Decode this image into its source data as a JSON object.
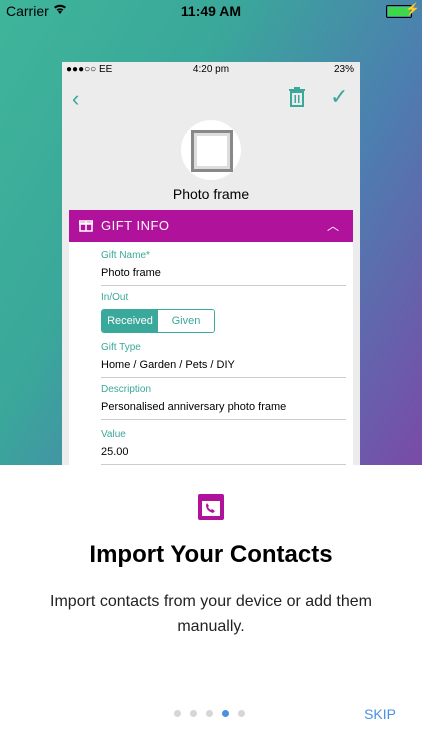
{
  "status": {
    "carrier": "Carrier",
    "time": "11:49 AM"
  },
  "inner": {
    "status": {
      "left": "●●●○○ EE",
      "time": "4:20 pm",
      "right": "23%"
    },
    "item_name": "Photo frame",
    "section_title": "GIFT INFO",
    "fields": {
      "gift_name_label": "Gift Name*",
      "gift_name_value": "Photo frame",
      "inout_label": "In/Out",
      "received": "Received",
      "given": "Given",
      "type_label": "Gift Type",
      "type_value": "Home / Garden / Pets / DIY",
      "desc_label": "Description",
      "desc_value": "Personalised anniversary photo frame",
      "value_label": "Value",
      "value_value": "25.00"
    }
  },
  "onboarding": {
    "title": "Import Your Contacts",
    "description": "Import contacts from your device or add them manually.",
    "skip": "SKIP",
    "page_index": 4,
    "page_count": 5
  },
  "colors": {
    "accent": "#3aa89a",
    "section": "#b0129c",
    "link": "#4a90e2"
  }
}
